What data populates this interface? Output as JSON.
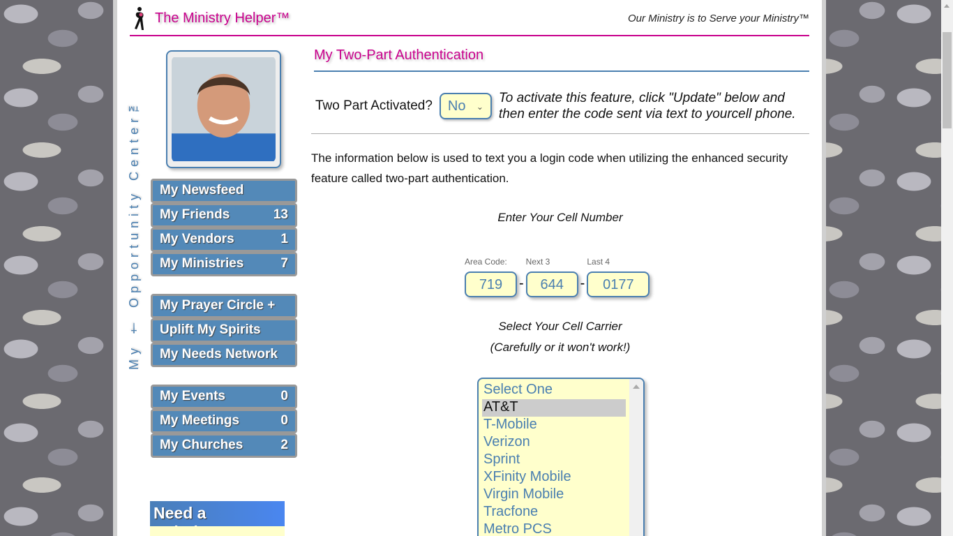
{
  "header": {
    "brand": "The Ministry Helper™",
    "tagline": "Our Ministry is to Serve your Ministry™"
  },
  "sidebar": {
    "vertical_label": "My † Opportunity Center™",
    "groups": [
      [
        {
          "label": "My Newsfeed",
          "count": ""
        },
        {
          "label": "My Friends",
          "count": "13"
        },
        {
          "label": "My Vendors",
          "count": "1"
        },
        {
          "label": "My Ministries",
          "count": "7"
        }
      ],
      [
        {
          "label": "My Prayer Circle +",
          "count": ""
        },
        {
          "label": "Uplift My Spirits",
          "count": ""
        },
        {
          "label": "My Needs Network",
          "count": ""
        }
      ],
      [
        {
          "label": "My Events",
          "count": "0"
        },
        {
          "label": "My Meetings",
          "count": "0"
        },
        {
          "label": "My Churches",
          "count": "2"
        }
      ]
    ],
    "solution": "Need a Solution?"
  },
  "main": {
    "title": "My Two-Part Authentication",
    "activated_label": "Two Part Activated?",
    "activated_value": "No",
    "activate_note": "To activate this feature, click \"Update\" below and then enter the code sent via text to yourcell phone.",
    "info": "The information below is used to text you a login code when utilizing the enhanced security feature called two-part authentication.",
    "cell_heading": "Enter Your Cell Number",
    "phone": {
      "area_label": "Area Code:",
      "area": "719",
      "next_label": "Next 3",
      "next": "644",
      "last_label": "Last 4",
      "last": "0177",
      "sep": "-"
    },
    "carrier_heading": "Select Your Cell Carrier",
    "carrier_warning": "(Carefully or it won't work!)",
    "carriers": [
      "Select One",
      "AT&T",
      "T-Mobile",
      "Verizon",
      "Sprint",
      "XFinity Mobile",
      "Virgin Mobile",
      "Tracfone",
      "Metro PCS"
    ],
    "selected_carrier": "AT&T"
  },
  "colors": {
    "brand": "#c8008c",
    "accent": "#4a7fb0",
    "nav": "#5389b8",
    "field": "#ffffcc"
  }
}
